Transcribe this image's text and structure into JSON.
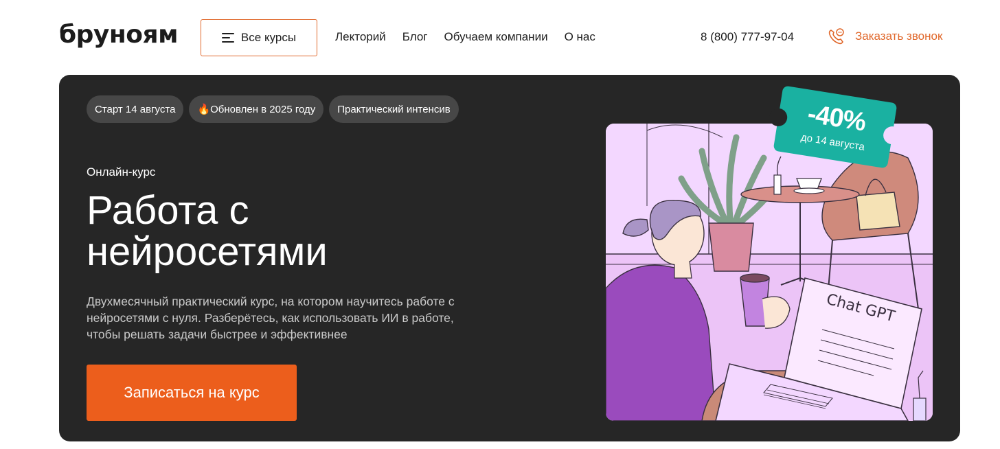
{
  "header": {
    "logo": "бруноям",
    "courses_button": "Все курсы",
    "nav": [
      "Лекторий",
      "Блог",
      "Обучаем компании",
      "О нас"
    ],
    "phone": "8 (800) 777-97-04",
    "callback_label": "Заказать звонок"
  },
  "hero": {
    "tags": [
      "Старт 14 августа",
      "🔥Обновлен в 2025 году",
      "Практический интенсив"
    ],
    "kind": "Онлайн-курс",
    "title_line1": "Работа с",
    "title_line2": "нейросетями",
    "description": "Двухмесячный практический курс, на котором научитесь работе с нейросетями с нуля. Разберётесь, как использовать ИИ в работе, чтобы решать задачи быстрее и эффективнее",
    "cta_label": "Записаться на курс",
    "discount": {
      "percent": "-40%",
      "until": "до 14 августа"
    },
    "illustration": {
      "screen_text": "Chat GPT"
    }
  },
  "colors": {
    "accent": "#ec5e1c",
    "hero_bg": "#262626",
    "tag_bg": "#474747",
    "badge": "#1ab1a1",
    "illustration_bg": "#f3d7ff"
  }
}
